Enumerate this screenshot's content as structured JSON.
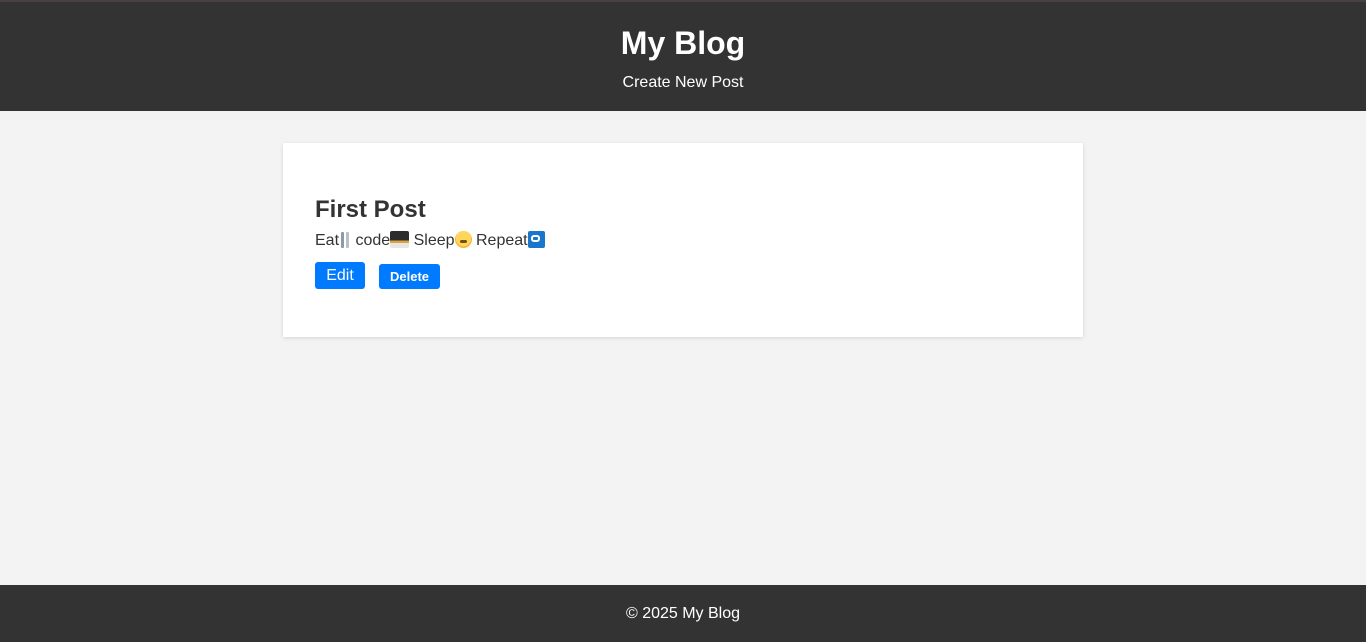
{
  "header": {
    "title": "My Blog",
    "nav_link": "Create New Post"
  },
  "posts": [
    {
      "title": "First Post",
      "body": {
        "word_1": "Eat",
        "word_2": "code",
        "word_3": "Sleep",
        "word_4": "Repeat",
        "icons": [
          "fork-knife-icon",
          "laptop-icon",
          "sleeping-face-icon",
          "repeat-icon"
        ]
      },
      "actions": {
        "edit_label": "Edit",
        "delete_label": "Delete"
      }
    }
  ],
  "footer": {
    "text": "© 2025 My Blog"
  },
  "colors": {
    "header_bg": "#333333",
    "page_bg": "#f3f3f3",
    "card_bg": "#ffffff",
    "button_bg": "#007bff",
    "footer_bg": "#333333"
  }
}
